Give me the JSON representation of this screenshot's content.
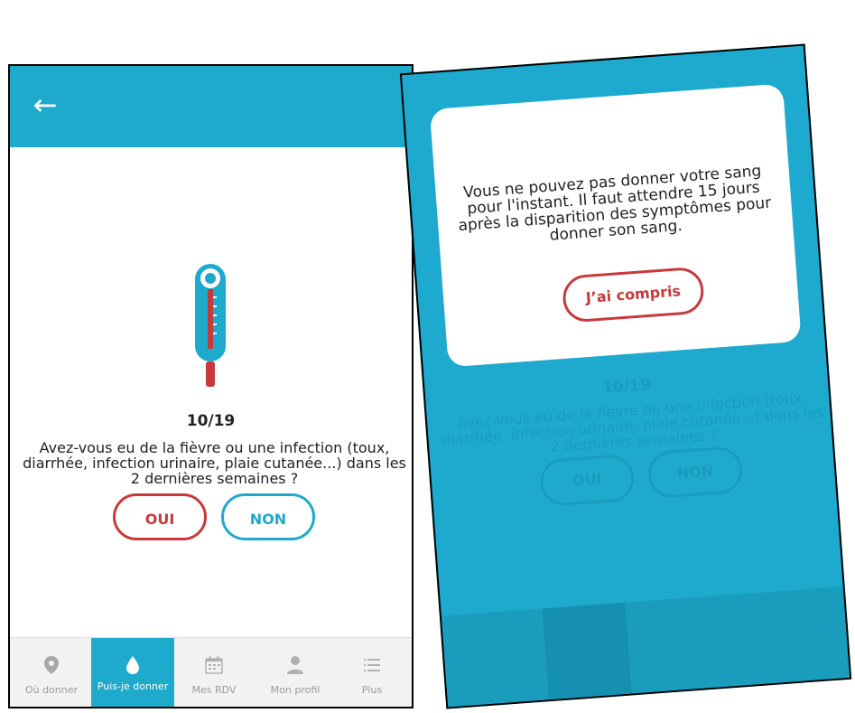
{
  "left": {
    "header": {
      "back_icon": "arrow-left-icon"
    },
    "illustration": "thermometer-icon",
    "question": {
      "counter": "10/19",
      "text": "Avez-vous eu de la fièvre ou une infection (toux, diarrhée, infection urinaire, plaie cutanée...) dans les 2 dernières semaines ?"
    },
    "answers": {
      "yes_label": "OUI",
      "no_label": "NON"
    },
    "nav": [
      {
        "label": "Où donner",
        "icon": "location-pin-icon",
        "active": false
      },
      {
        "label": "Puis-je donner",
        "icon": "blood-drop-icon",
        "active": true
      },
      {
        "label": "Mes RDV",
        "icon": "calendar-icon",
        "active": false
      },
      {
        "label": "Mon profil",
        "icon": "person-icon",
        "active": false
      },
      {
        "label": "Plus",
        "icon": "menu-list-icon",
        "active": false
      }
    ]
  },
  "right": {
    "dialog": {
      "message": "Vous ne pouvez pas donner votre sang pour l'instant. Il faut attendre 15 jours après la disparition des symptômes pour donner son sang.",
      "button_label": "J’ai compris"
    },
    "background": {
      "counter": "10/19",
      "text": "Avez-vous eu de la fièvre ou une infection (toux, diarrhée, infection urinaire, plaie cutanée...) dans les 2 dernières semaines ?",
      "yes_label": "OUI",
      "no_label": "NON"
    }
  },
  "colors": {
    "brand_blue": "#1eaacd",
    "brand_red": "#c8393c",
    "overlay_blue": "#1ea9cf"
  }
}
